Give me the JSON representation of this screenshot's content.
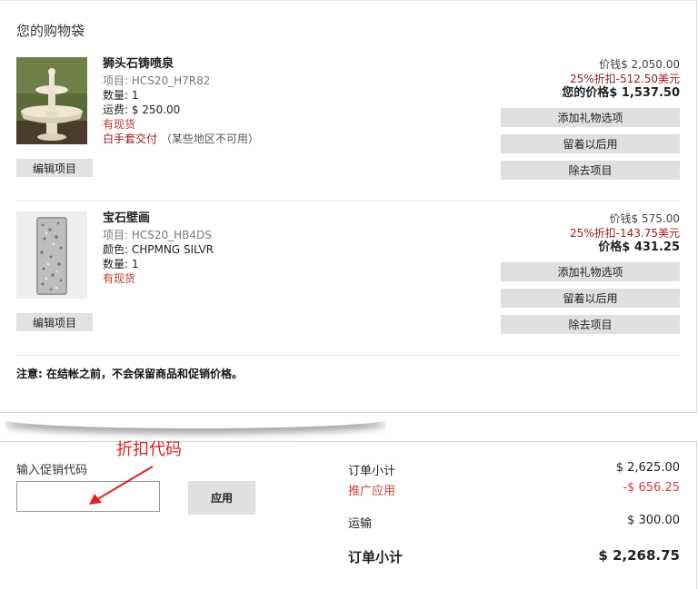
{
  "bag": {
    "title": "您的购物袋",
    "items": [
      {
        "name": "狮头石铸喷泉",
        "sku": "项目: HCS20_H7R82",
        "qty": "数量: 1",
        "shipping": "运费: $ 250.00",
        "stock": "有现货",
        "delivery": "白手套交付",
        "delivery_note": "（某些地区不可用）",
        "price_orig": "价钱$ 2,050.00",
        "price_disc": "25%折扣-512.50美元",
        "price_final": "您的价格$ 1,537.50",
        "edit_label": "编辑项目",
        "actions": [
          "添加礼物选项",
          "留着以后用",
          "除去项目"
        ]
      },
      {
        "name": "宝石壁画",
        "sku": "项目: HCS20_HB4DS",
        "color": "颜色: CHPMNG SILVR",
        "qty": "数量: 1",
        "stock": "有现货",
        "price_orig": "价钱$ 575.00",
        "price_disc": "25%折扣-143.75美元",
        "price_final": "价格$ 431.25",
        "edit_label": "编辑项目",
        "actions": [
          "添加礼物选项",
          "留着以后用",
          "除去项目"
        ]
      }
    ],
    "note": "注意: 在结帐之前，不会保留商品和促销价格。"
  },
  "promo": {
    "annotation": "折扣代码",
    "label": "输入促销代码",
    "input_value": "",
    "apply_label": "应用"
  },
  "summary": {
    "subtotal_label": "订单小计",
    "subtotal_value": "$ 2,625.00",
    "promo_label": "推广应用",
    "promo_value": "-$ 656.25",
    "shipping_label": "运输",
    "shipping_value": "$ 300.00",
    "total_label": "订单小计",
    "total_value": "$ 2,268.75"
  },
  "colors": {
    "red_accent": "#c0392b",
    "annotation_red": "#e02020",
    "button_gray": "#e0e0e0"
  }
}
